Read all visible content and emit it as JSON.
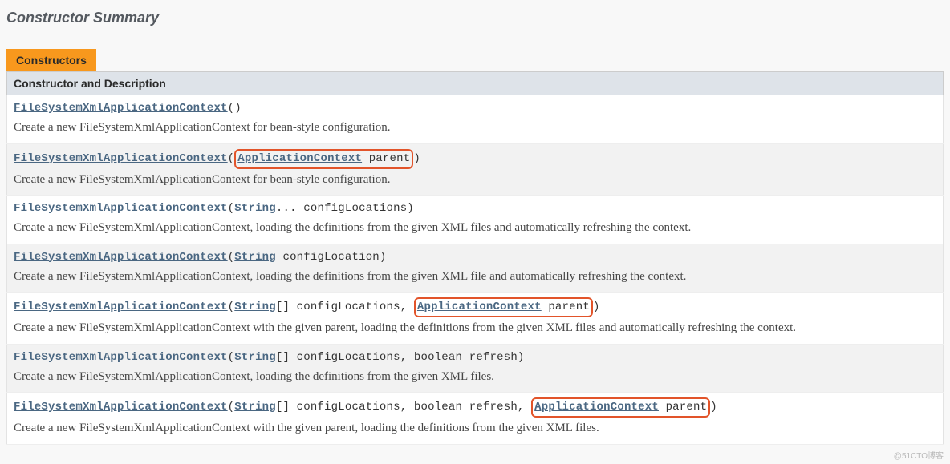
{
  "section_title": "Constructor Summary",
  "tab": "Constructors",
  "header": "Constructor and Description",
  "class_name": "FileSystemXmlApplicationContext",
  "rows": [
    {
      "sig_parts": [
        {
          "kind": "ctor"
        },
        {
          "kind": "plain",
          "text": "()"
        }
      ],
      "highlighted": false,
      "desc": "Create a new FileSystemXmlApplicationContext for bean-style configuration."
    },
    {
      "sig_parts": [
        {
          "kind": "ctor"
        },
        {
          "kind": "plain",
          "text": "("
        },
        {
          "kind": "hl_open"
        },
        {
          "kind": "linktype",
          "text": "ApplicationContext"
        },
        {
          "kind": "plain",
          "text": " parent"
        },
        {
          "kind": "hl_close"
        },
        {
          "kind": "plain",
          "text": ")"
        }
      ],
      "highlighted": true,
      "desc": "Create a new FileSystemXmlApplicationContext for bean-style configuration."
    },
    {
      "sig_parts": [
        {
          "kind": "ctor"
        },
        {
          "kind": "plain",
          "text": "("
        },
        {
          "kind": "linktype",
          "text": "String"
        },
        {
          "kind": "plain",
          "text": "... configLocations)"
        }
      ],
      "highlighted": false,
      "desc": "Create a new FileSystemXmlApplicationContext, loading the definitions from the given XML files and automatically refreshing the context."
    },
    {
      "sig_parts": [
        {
          "kind": "ctor"
        },
        {
          "kind": "plain",
          "text": "("
        },
        {
          "kind": "linktype",
          "text": "String"
        },
        {
          "kind": "plain",
          "text": " configLocation)"
        }
      ],
      "highlighted": false,
      "desc": "Create a new FileSystemXmlApplicationContext, loading the definitions from the given XML file and automatically refreshing the context."
    },
    {
      "sig_parts": [
        {
          "kind": "ctor"
        },
        {
          "kind": "plain",
          "text": "("
        },
        {
          "kind": "linktype",
          "text": "String"
        },
        {
          "kind": "plain",
          "text": "[] configLocations, "
        },
        {
          "kind": "hl_open"
        },
        {
          "kind": "linktype",
          "text": "ApplicationContext"
        },
        {
          "kind": "plain",
          "text": " parent"
        },
        {
          "kind": "hl_close"
        },
        {
          "kind": "plain",
          "text": ")"
        }
      ],
      "highlighted": true,
      "desc": "Create a new FileSystemXmlApplicationContext with the given parent, loading the definitions from the given XML files and automatically refreshing the context."
    },
    {
      "sig_parts": [
        {
          "kind": "ctor"
        },
        {
          "kind": "plain",
          "text": "("
        },
        {
          "kind": "linktype",
          "text": "String"
        },
        {
          "kind": "plain",
          "text": "[] configLocations, boolean refresh)"
        }
      ],
      "highlighted": false,
      "desc": "Create a new FileSystemXmlApplicationContext, loading the definitions from the given XML files."
    },
    {
      "sig_parts": [
        {
          "kind": "ctor"
        },
        {
          "kind": "plain",
          "text": "("
        },
        {
          "kind": "linktype",
          "text": "String"
        },
        {
          "kind": "plain",
          "text": "[] configLocations, boolean refresh, "
        },
        {
          "kind": "hl_open"
        },
        {
          "kind": "linktype",
          "text": "ApplicationContext"
        },
        {
          "kind": "plain",
          "text": " parent"
        },
        {
          "kind": "hl_close"
        },
        {
          "kind": "plain",
          "text": ")"
        }
      ],
      "highlighted": true,
      "desc": "Create a new FileSystemXmlApplicationContext with the given parent, loading the definitions from the given XML files."
    }
  ],
  "watermark": "@51CTO博客"
}
